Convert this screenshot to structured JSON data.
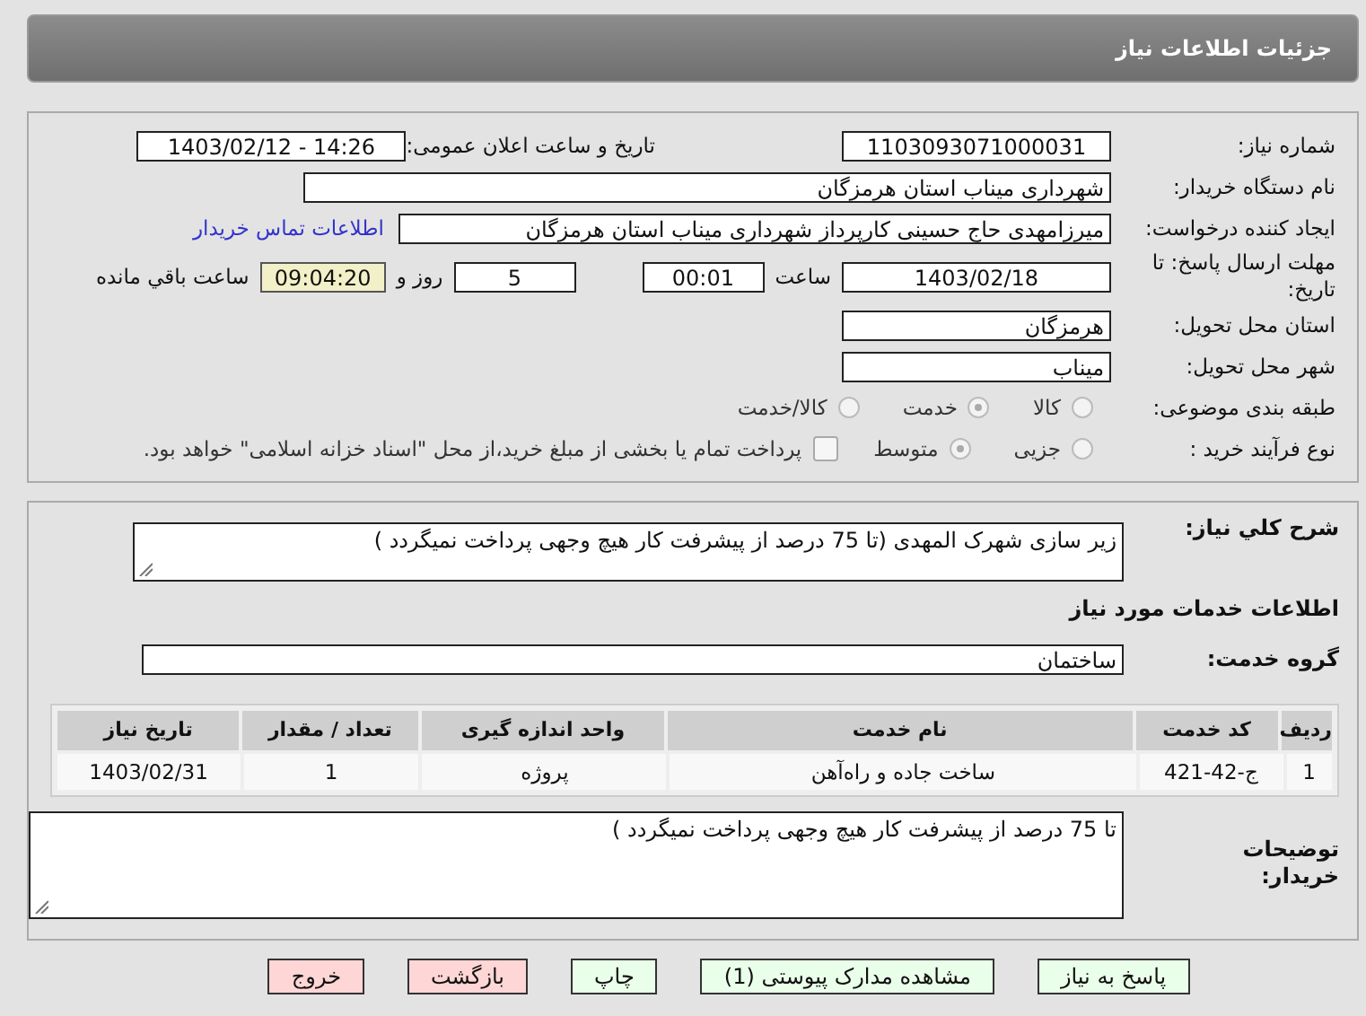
{
  "header": {
    "title": "جزئیات اطلاعات نیاز"
  },
  "details": {
    "need_number": {
      "label": "شماره نیاز:",
      "value": "1103093071000031"
    },
    "announce": {
      "label": "تاریخ و ساعت اعلان عمومی:",
      "value": "1403/02/12 - 14:26"
    },
    "buyer_org": {
      "label": "نام دستگاه خریدار:",
      "value": "شهرداری میناب استان هرمزگان"
    },
    "creator": {
      "label": "ایجاد کننده درخواست:",
      "value": "میرزامهدی حاج حسینی کارپرداز شهرداری میناب استان هرمزگان",
      "link": "اطلاعات تماس خریدار"
    },
    "deadline": {
      "label": "مهلت ارسال پاسخ: تا تاریخ:",
      "date": "1403/02/18",
      "time_label": "ساعت",
      "time": "00:01",
      "days": "5",
      "days_label": "روز و",
      "remaining": "09:04:20",
      "remaining_label": "ساعت باقي مانده"
    },
    "province": {
      "label": "استان محل تحویل:",
      "value": "هرمزگان"
    },
    "city": {
      "label": "شهر محل تحویل:",
      "value": "میناب"
    },
    "category": {
      "label": "طبقه بندی موضوعی:",
      "options": [
        {
          "label": "کالا",
          "selected": false
        },
        {
          "label": "خدمت",
          "selected": true
        },
        {
          "label": "کالا/خدمت",
          "selected": false
        }
      ]
    },
    "process": {
      "label": "نوع فرآیند خرید :",
      "options": [
        {
          "label": "جزیی",
          "selected": false
        },
        {
          "label": "متوسط",
          "selected": true
        }
      ],
      "payment": {
        "checked": false,
        "text": "پرداخت تمام یا بخشی از مبلغ خرید،از محل \"اسناد خزانه اسلامی\" خواهد بود."
      }
    }
  },
  "summary": {
    "description": {
      "label": "شرح کلي نیاز:",
      "value": "زیر سازی شهرک المهدی (تا 75 درصد از پیشرفت کار هیچ وجهی پرداخت نمیگردد )"
    },
    "services_heading": "اطلاعات خدمات مورد نیاز",
    "service_group": {
      "label": "گروه خدمت:",
      "value": "ساختمان"
    },
    "table": {
      "columns": [
        "ردیف",
        "کد خدمت",
        "نام خدمت",
        "واحد اندازه گیری",
        "تعداد / مقدار",
        "تاریخ نیاز"
      ],
      "rows": [
        [
          "1",
          "ج-42-421",
          "ساخت جاده و راه‌آهن",
          "پروژه",
          "1",
          "1403/02/31"
        ]
      ]
    },
    "notes": {
      "label": "توضیحات خریدار:",
      "value": "تا 75 درصد از پیشرفت کار هیچ وجهی پرداخت نمیگردد )"
    }
  },
  "buttons": [
    {
      "label": "پاسخ به نیاز",
      "kind": "ok"
    },
    {
      "label": "مشاهده مدارک پیوستی (1)",
      "kind": "ok"
    },
    {
      "label": "چاپ",
      "kind": "ok"
    },
    {
      "label": "بازگشت",
      "kind": "danger"
    },
    {
      "label": "خروج",
      "kind": "danger"
    }
  ]
}
